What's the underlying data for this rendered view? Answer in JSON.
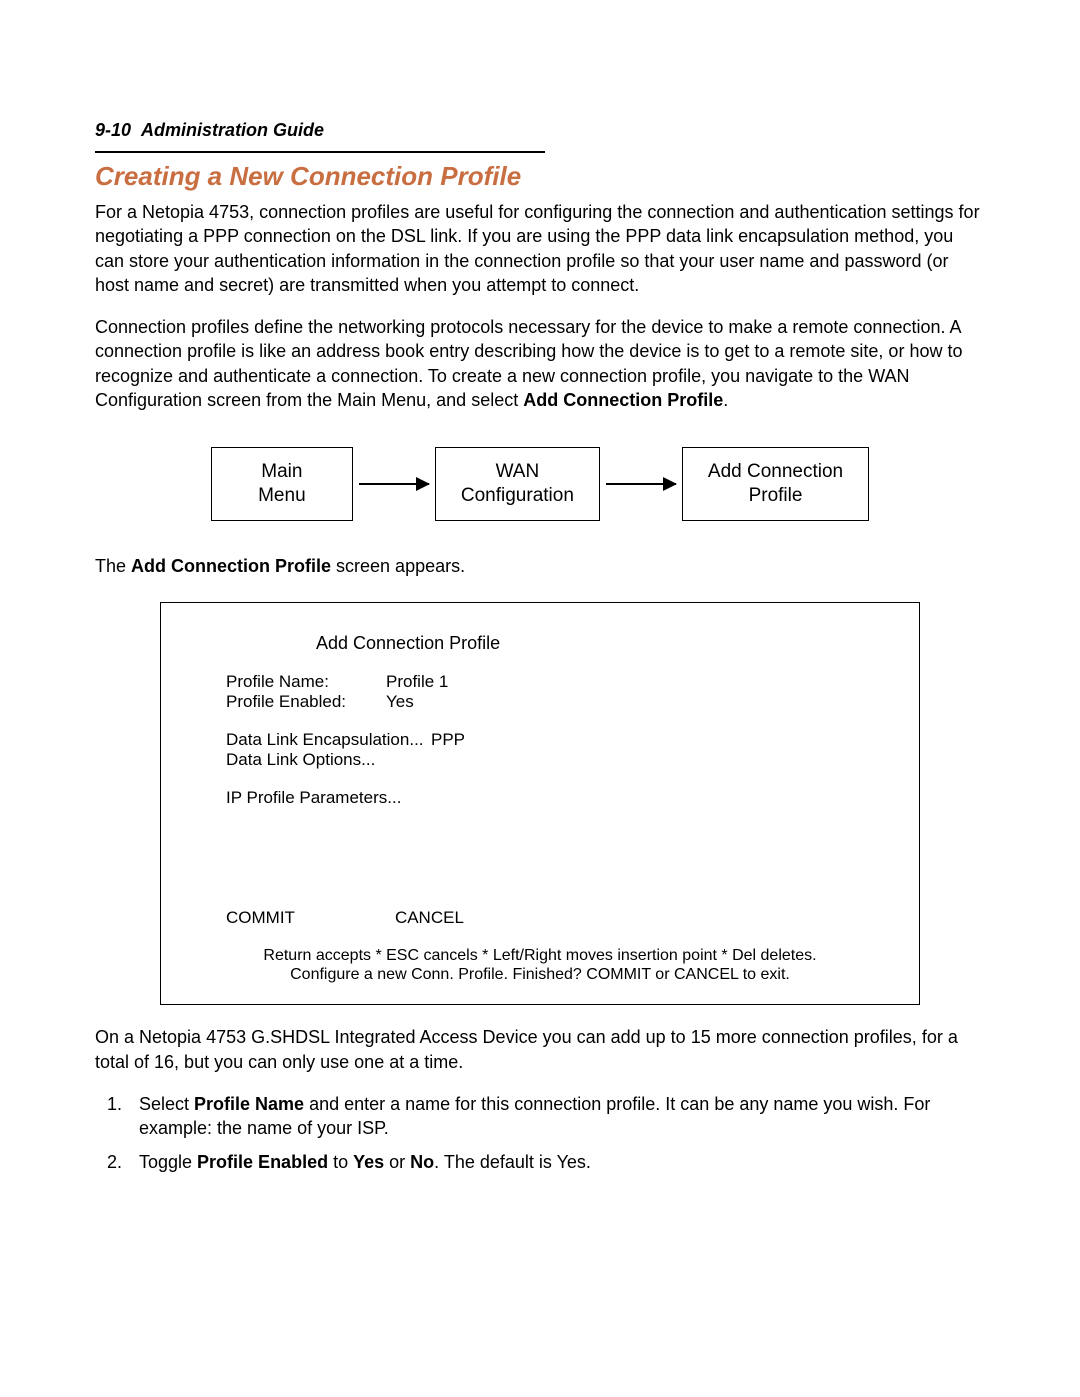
{
  "header": {
    "page_ref": "9-10",
    "guide_title": "Administration Guide"
  },
  "section_title": "Creating a New Connection Profile",
  "paragraph1": "For a Netopia 4753, connection profiles are useful for configuring the connection and authentication settings for negotiating a PPP connection on the DSL link. If you are using the PPP data link encapsulation method, you can store your authentication information in the connection profile so that your user name and password (or host name and secret) are transmitted when you attempt to connect.",
  "paragraph2_a": "Connection profiles define the networking protocols necessary for the device to make a remote connection. A connection profile is like an address book entry describing how the device is to get to a remote site, or how to recognize and authenticate a connection. To create a new connection profile, you navigate to the WAN Configuration screen from the Main Menu, and select ",
  "paragraph2_bold": "Add Connection Profile",
  "paragraph2_b": ".",
  "nav": {
    "box1_line1": "Main",
    "box1_line2": "Menu",
    "box2_line1": "WAN",
    "box2_line2": "Configuration",
    "box3_line1": "Add Connection",
    "box3_line2": "Profile"
  },
  "screen_intro_a": "The ",
  "screen_intro_bold": "Add Connection Profile",
  "screen_intro_b": " screen appears.",
  "terminal": {
    "title": "Add Connection Profile",
    "rows": {
      "profile_name_label": "Profile Name:",
      "profile_name_value": "Profile 1",
      "profile_enabled_label": "Profile Enabled:",
      "profile_enabled_value": "Yes",
      "encap_label": "Data Link Encapsulation...",
      "encap_value": "PPP",
      "options_label": "Data Link Options...",
      "ip_params_label": "IP Profile Parameters..."
    },
    "actions": {
      "commit": "COMMIT",
      "cancel": "CANCEL"
    },
    "footer_line1": "Return accepts * ESC cancels * Left/Right moves insertion point * Del deletes.",
    "footer_line2": "Configure a new Conn. Profile. Finished?  COMMIT or CANCEL to exit."
  },
  "paragraph3": "On a Netopia 4753 G.SHDSL Integrated Access Device you can add up to 15 more connection profiles, for a total of 16, but you can only use one at a time.",
  "steps": {
    "s1_a": "Select ",
    "s1_bold": "Profile Name",
    "s1_b": " and enter a name for this connection profile. It can be any name you wish. For example: the name of your ISP.",
    "s2_a": "Toggle ",
    "s2_bold1": "Profile Enabled",
    "s2_b": " to ",
    "s2_bold2": "Yes",
    "s2_c": " or ",
    "s2_bold3": "No",
    "s2_d": ". The default is Yes."
  }
}
